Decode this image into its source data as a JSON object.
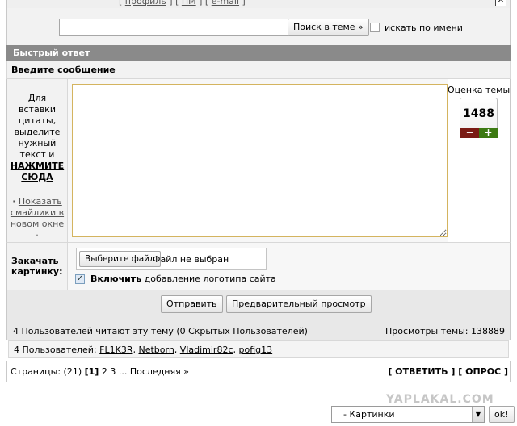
{
  "top": {
    "bracket_open": "[",
    "profile": "профиль",
    "sep": "] [",
    "pm": "ПМ",
    "email": "e-mail",
    "bracket_close": "]",
    "close_glyph": "✕"
  },
  "search": {
    "input_value": "",
    "button_label": "Поиск в теме »",
    "by_name_label": "искать по имени"
  },
  "quick_reply": {
    "header": "Быстрый ответ",
    "subheader": "Введите сообщение",
    "hint_lines": [
      "Для",
      "вставки",
      "цитаты,",
      "выделите",
      "нужный",
      "текст и"
    ],
    "hint_action": [
      "НАЖМИТЕ",
      "СЮДА"
    ],
    "smiles_lines": [
      "Показать",
      "смайлики в",
      "новом окне"
    ],
    "smiles_prefix": "·",
    "smiles_suffix": "·",
    "message_value": ""
  },
  "rating": {
    "title": "Оценка темы",
    "value": "1488",
    "minus": "−",
    "plus": "+"
  },
  "upload": {
    "label_line1": "Закачать",
    "label_line2": "картинку:",
    "choose_button": "Выберите файл",
    "no_file": "Файл не выбран",
    "logo_checked": true,
    "logo_bold": "Включить",
    "logo_rest": "добавление логотипа сайта"
  },
  "actions": {
    "submit": "Отправить",
    "preview": "Предварительный просмотр"
  },
  "stats": {
    "readers": "4 Пользователей читают эту тему (0 Скрытых Пользователей)",
    "views": "Просмотры темы: 138889"
  },
  "users": {
    "prefix": "4 Пользователей:",
    "list": [
      "FL1K3R",
      "Netborn",
      "Vladimir82c",
      "pofig13"
    ]
  },
  "pagination": {
    "label": "Страницы:",
    "total": "(21)",
    "current": "[1]",
    "p2": "2",
    "p3": "3",
    "ellipsis": "...",
    "last": "Последняя »",
    "reply": "[ ОТВЕТИТЬ ]",
    "poll": "[ ОПРОС ]"
  },
  "watermark": "YAPLAKAL.COM",
  "jump": {
    "selected": "- Картинки",
    "go": "ok!"
  }
}
